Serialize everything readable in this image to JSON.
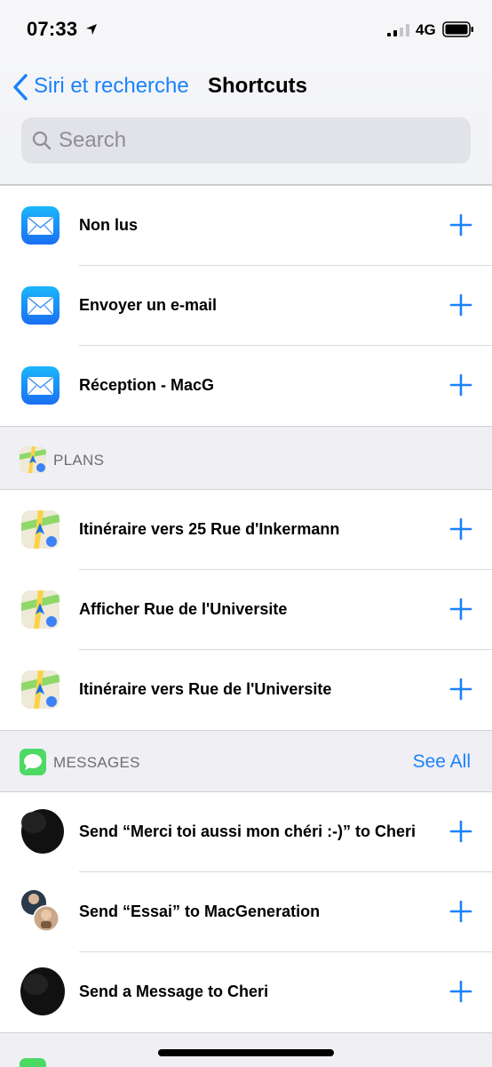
{
  "status_bar": {
    "time": "07:33",
    "network": "4G"
  },
  "nav": {
    "back_label": "Siri et recherche",
    "title": "Shortcuts"
  },
  "search": {
    "placeholder": "Search"
  },
  "mail_group": {
    "items": [
      {
        "label": "Non lus",
        "icon": "mail-icon"
      },
      {
        "label": "Envoyer un e-mail",
        "icon": "mail-icon"
      },
      {
        "label": "Réception - MacG",
        "icon": "mail-icon"
      }
    ]
  },
  "plans_section": {
    "title": "PLANS",
    "items": [
      {
        "label": "Itinéraire vers 25 Rue d'Inkermann",
        "icon": "maps-icon"
      },
      {
        "label": "Afficher Rue de l'Universite",
        "icon": "maps-icon"
      },
      {
        "label": "Itinéraire vers Rue de l'Universite",
        "icon": "maps-icon"
      }
    ]
  },
  "messages_section": {
    "title": "MESSAGES",
    "see_all": "See All",
    "items": [
      {
        "label": "Send “Merci toi aussi mon chéri :-)” to Cheri",
        "icon": "avatar"
      },
      {
        "label": "Send “Essai” to MacGeneration",
        "icon": "avatar-group"
      },
      {
        "label": "Send a Message to Cheri",
        "icon": "avatar"
      }
    ]
  },
  "colors": {
    "accent": "#1a82fb",
    "background": "#efeff4",
    "secondary_text": "#6d6d72"
  }
}
